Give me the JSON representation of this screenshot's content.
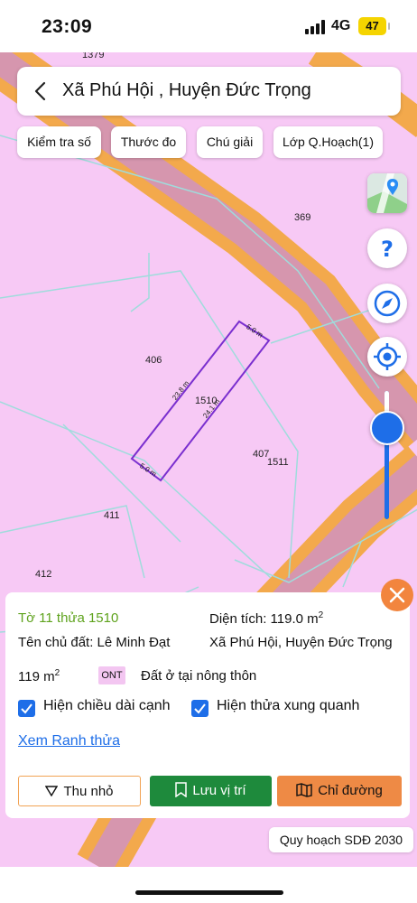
{
  "status": {
    "time": "23:09",
    "network": "4G",
    "battery": "47"
  },
  "search": {
    "title": "Xã Phú Hội , Huyện Đức Trọng"
  },
  "chips": [
    "Kiểm tra số",
    "Thước đo",
    "Chú giải",
    "Lớp Q.Hoạch(1)"
  ],
  "map": {
    "labels": [
      "1379",
      "369",
      "406",
      "1510",
      "407",
      "1511",
      "411",
      "412"
    ],
    "edges": [
      "5.0 m",
      "23.8 m",
      "24.1 m",
      "5.0 m"
    ],
    "colors": {
      "residential": "#f7c9f5",
      "road": "#f3a94c",
      "road_inner": "#c98fd8",
      "parcel_outline": "#7a2fcf",
      "boundary": "#9fdcdc"
    }
  },
  "zoom": {
    "level": 0.27
  },
  "panel": {
    "parcel_id": "Tờ 11 thửa 1510",
    "area_label": "Diện tích: 119.0 m",
    "area_sup": "2",
    "owner": "Tên chủ đất: Lê Minh Đạt",
    "location": "Xã Phú Hội, Huyện Đức Trọng",
    "area_short": "119 m",
    "area_short_sup": "2",
    "land_code": "ONT",
    "land_type": "Đất ở tại nông thôn",
    "check_edges": "Hiện chiều dài cạnh",
    "check_neighbors": "Hiện thửa xung quanh",
    "link": "Xem Ranh thửa",
    "btn_collapse": "Thu nhỏ",
    "btn_save": "Lưu vị trí",
    "btn_route": "Chỉ đường"
  },
  "plan_badge": "Quy hoạch SDĐ 2030"
}
